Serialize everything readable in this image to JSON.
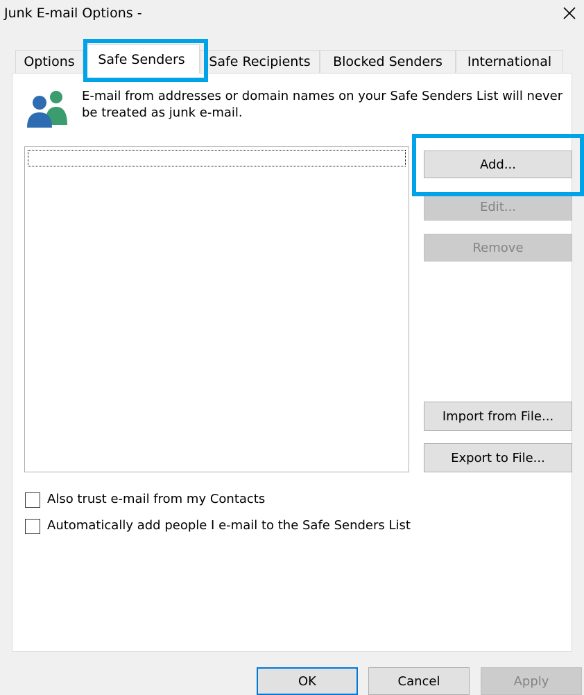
{
  "window": {
    "title": "Junk E-mail Options -"
  },
  "tabs": [
    {
      "label": "Options"
    },
    {
      "label": "Safe Senders"
    },
    {
      "label": "Safe Recipients"
    },
    {
      "label": "Blocked Senders"
    },
    {
      "label": "International"
    }
  ],
  "safe_senders": {
    "description": "E-mail from addresses or domain names on your Safe Senders List will never be treated as junk e-mail.",
    "icon": "people-icon",
    "list_items": [],
    "buttons": {
      "add": "Add...",
      "edit": "Edit...",
      "remove": "Remove",
      "import": "Import from File...",
      "export": "Export to File..."
    },
    "checkboxes": [
      {
        "label": "Also trust e-mail from my Contacts",
        "checked": false
      },
      {
        "label": "Automatically add people I e-mail to the Safe Senders List",
        "checked": false
      }
    ]
  },
  "footer": {
    "ok": "OK",
    "cancel": "Cancel",
    "apply": "Apply"
  },
  "colors": {
    "highlight": "#00a2e8",
    "window_bg": "#f0f0f0",
    "panel_bg": "#ffffff"
  }
}
